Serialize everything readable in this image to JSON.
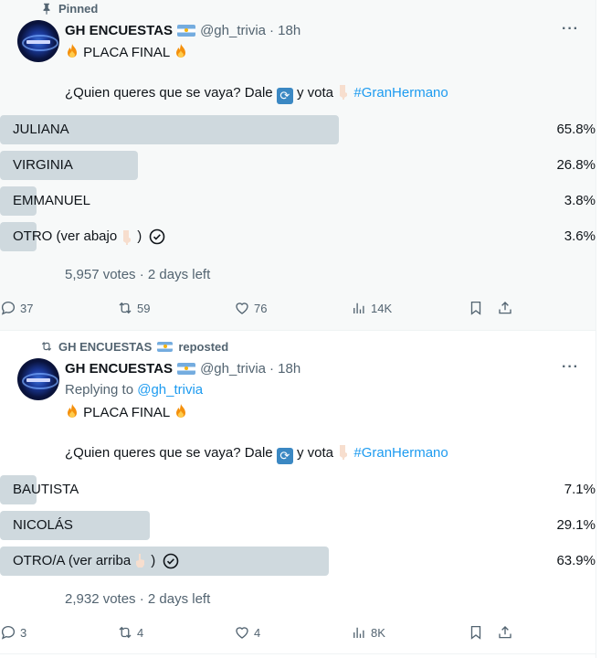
{
  "tweets": [
    {
      "social_context": "Pinned",
      "author_name": "GH ENCUESTAS",
      "author_handle": "@gh_trivia",
      "time": "· 18h",
      "replying_to_label": "",
      "replying_to_handle": "",
      "title_text": "PLACA FINAL",
      "body_text_1": "¿Quien queres que se vaya? Dale",
      "body_text_2": "y vota",
      "hashtag": "#GranHermano",
      "poll": {
        "options": [
          {
            "label": "JULIANA",
            "percent_text": "65.8%",
            "percent": 65.8,
            "voted": false
          },
          {
            "label": "VIRGINIA",
            "percent_text": "26.8%",
            "percent": 26.8,
            "voted": false
          },
          {
            "label": "EMMANUEL",
            "percent_text": "3.8%",
            "percent": 3.8,
            "voted": false
          },
          {
            "label": "OTRO (ver abajo",
            "label_suffix": ")",
            "emoji": "pointing-down",
            "percent_text": "3.6%",
            "percent": 3.6,
            "voted": true
          }
        ],
        "votes_text": "5,957 votes · 2 days left"
      },
      "actions": {
        "replies": "37",
        "reposts": "59",
        "likes": "76",
        "views": "14K"
      }
    },
    {
      "social_context": "GH ENCUESTAS",
      "social_context_suffix": "reposted",
      "author_name": "GH ENCUESTAS",
      "author_handle": "@gh_trivia",
      "time": "· 18h",
      "replying_to_label": "Replying to",
      "replying_to_handle": "@gh_trivia",
      "title_text": "PLACA FINAL",
      "body_text_1": "¿Quien queres que se vaya? Dale",
      "body_text_2": "y vota",
      "hashtag": "#GranHermano",
      "poll": {
        "options": [
          {
            "label": "BAUTISTA",
            "percent_text": "7.1%",
            "percent": 7.1,
            "voted": false
          },
          {
            "label": "NICOLÁS",
            "percent_text": "29.1%",
            "percent": 29.1,
            "voted": false
          },
          {
            "label": "OTRO/A (ver arriba",
            "label_suffix": ")",
            "emoji": "pointing-up",
            "percent_text": "63.9%",
            "percent": 63.9,
            "voted": true
          }
        ],
        "votes_text": "2,932 votes · 2 days left"
      },
      "actions": {
        "replies": "3",
        "reposts": "4",
        "likes": "4",
        "views": "8K"
      }
    }
  ],
  "icons": {
    "pin": "pin-icon",
    "repost": "repost-icon",
    "more": "more-icon",
    "reply": "reply-icon",
    "like": "heart-icon",
    "views": "views-icon",
    "bookmark": "bookmark-icon",
    "share": "share-icon",
    "check": "check-circle-icon"
  },
  "more_label": "···",
  "colors": {
    "accent": "#1d9bf0",
    "bar": "#cfd9de",
    "muted": "#536471",
    "pinned_bg": "#f7f9f9"
  }
}
